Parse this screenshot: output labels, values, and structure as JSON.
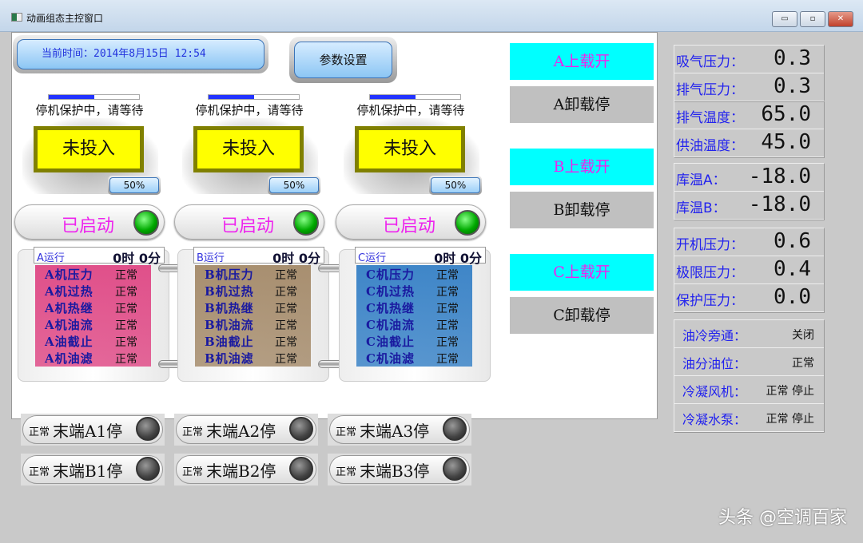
{
  "window": {
    "title": "动画组态主控窗口",
    "minimize": "▭",
    "maximize": "▫",
    "close": "✕"
  },
  "header": {
    "time": "当前时间：2014年8月15日 12:54",
    "settings_label": "参数设置"
  },
  "units": [
    {
      "id": "A",
      "progress": 0.5,
      "wait": "停机保护中，请等待",
      "state": "未投入",
      "pct": "50%",
      "status": "已启动",
      "run_label": "A运行",
      "run_time": "0时  0分",
      "color": "#e0508a",
      "rows": [
        {
          "k": "A机压力",
          "v": "正常"
        },
        {
          "k": "A机过热",
          "v": "正常"
        },
        {
          "k": "A机热继",
          "v": "正常"
        },
        {
          "k": "A机油流",
          "v": "正常"
        },
        {
          "k": "A油截止",
          "v": "正常"
        },
        {
          "k": "A机油滤",
          "v": "正常"
        }
      ]
    },
    {
      "id": "B",
      "progress": 0.5,
      "wait": "停机保护中，请等待",
      "state": "未投入",
      "pct": "50%",
      "status": "已启动",
      "run_label": "B运行",
      "run_time": "0时  0分",
      "color": "#a88f70",
      "rows": [
        {
          "k": "B机压力",
          "v": "正常"
        },
        {
          "k": "B机过热",
          "v": "正常"
        },
        {
          "k": "B机热继",
          "v": "正常"
        },
        {
          "k": "B机油流",
          "v": "正常"
        },
        {
          "k": "B油截止",
          "v": "正常"
        },
        {
          "k": "B机油滤",
          "v": "正常"
        }
      ]
    },
    {
      "id": "C",
      "progress": 0.5,
      "wait": "停机保护中，请等待",
      "state": "未投入",
      "pct": "50%",
      "status": "已启动",
      "run_label": "C运行",
      "run_time": "0时  0分",
      "color": "#3f86c8",
      "rows": [
        {
          "k": "C机压力",
          "v": "正常"
        },
        {
          "k": "C机过热",
          "v": "正常"
        },
        {
          "k": "C机热继",
          "v": "正常"
        },
        {
          "k": "C机油流",
          "v": "正常"
        },
        {
          "k": "C油截止",
          "v": "正常"
        },
        {
          "k": "C机油滤",
          "v": "正常"
        }
      ]
    }
  ],
  "load_buttons": [
    {
      "on": "A上载开",
      "off": "A卸载停"
    },
    {
      "on": "B上载开",
      "off": "B卸载停"
    },
    {
      "on": "C上载开",
      "off": "C卸载停"
    }
  ],
  "readings": [
    [
      {
        "k": "吸气压力：",
        "v": "0.3"
      },
      {
        "k": "排气压力：",
        "v": "0.3"
      }
    ],
    [
      {
        "k": "排气温度：",
        "v": "65.0"
      },
      {
        "k": "供油温度：",
        "v": "45.0"
      }
    ],
    [
      {
        "k": "库温A：",
        "v": "-18.0"
      },
      {
        "k": "库温B：",
        "v": "-18.0"
      }
    ],
    [
      {
        "k": "开机压力：",
        "v": "0.6"
      },
      {
        "k": "极限压力：",
        "v": "0.4"
      },
      {
        "k": "保护压力：",
        "v": "0.0"
      }
    ]
  ],
  "status_rows": [
    {
      "k": "油冷旁通：",
      "v": "关闭"
    },
    {
      "k": "油分油位：",
      "v": "正常"
    },
    {
      "k": "冷凝风机：",
      "v": "正常 停止"
    },
    {
      "k": "冷凝水泵：",
      "v": "正常 停止"
    }
  ],
  "end_buttons": [
    {
      "s": "正常",
      "t": "末端A1停"
    },
    {
      "s": "正常",
      "t": "末端A2停"
    },
    {
      "s": "正常",
      "t": "末端A3停"
    },
    {
      "s": "正常",
      "t": "末端B1停"
    },
    {
      "s": "正常",
      "t": "末端B2停"
    },
    {
      "s": "正常",
      "t": "末端B3停"
    }
  ],
  "watermark": "头条 @空调百家"
}
